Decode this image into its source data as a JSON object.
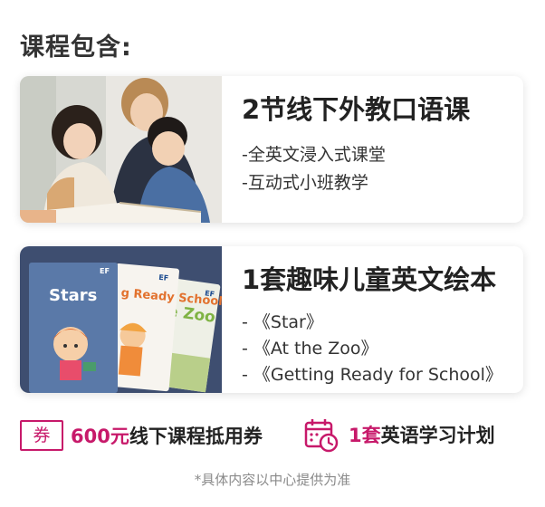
{
  "section_title": "课程包含:",
  "cards": [
    {
      "title": "2节线下外教口语课",
      "features": [
        "-全英文浸入式课堂",
        "-互动式小班教学"
      ]
    },
    {
      "title": "1套趣味儿童英文绘本",
      "features": [
        "- 《Star》",
        "- 《At the Zoo》",
        "- 《Getting Ready for School》"
      ],
      "book_covers": {
        "book1_title": "Stars",
        "book2_title": "g Ready School",
        "book3_title": "e Zoo",
        "brand": "EF"
      }
    }
  ],
  "coupon": {
    "badge": "券",
    "amount": "600元",
    "text": "线下课程抵用券"
  },
  "plan": {
    "icon": "calendar-clock-icon",
    "count": "1套",
    "text": "英语学习计划"
  },
  "footnote": "*具体内容以中心提供为准",
  "colors": {
    "accent": "#c7196a",
    "book_bg": "#3e4e70",
    "text_dark": "#222222",
    "footnote": "#8a8a8a"
  }
}
